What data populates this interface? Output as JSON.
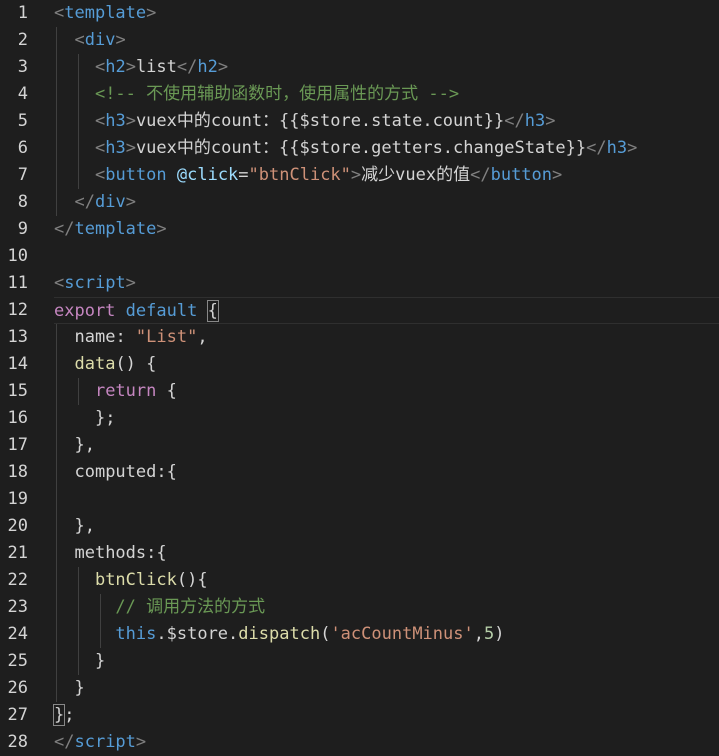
{
  "editor": {
    "line_numbers": [
      "1",
      "2",
      "3",
      "4",
      "5",
      "6",
      "7",
      "8",
      "9",
      "10",
      "11",
      "12",
      "13",
      "14",
      "15",
      "16",
      "17",
      "18",
      "19",
      "20",
      "21",
      "22",
      "23",
      "24",
      "25",
      "26",
      "27",
      "28"
    ],
    "lines": [
      [
        {
          "t": "<",
          "c": "punct"
        },
        {
          "t": "template",
          "c": "tag"
        },
        {
          "t": ">",
          "c": "punct"
        }
      ],
      [
        {
          "t": "  "
        },
        {
          "t": "<",
          "c": "punct"
        },
        {
          "t": "div",
          "c": "tag"
        },
        {
          "t": ">",
          "c": "punct"
        }
      ],
      [
        {
          "t": "    "
        },
        {
          "t": "<",
          "c": "punct"
        },
        {
          "t": "h2",
          "c": "tag"
        },
        {
          "t": ">",
          "c": "punct"
        },
        {
          "t": "list",
          "c": "txt"
        },
        {
          "t": "</",
          "c": "punct"
        },
        {
          "t": "h2",
          "c": "tag"
        },
        {
          "t": ">",
          "c": "punct"
        }
      ],
      [
        {
          "t": "    "
        },
        {
          "t": "<!-- 不使用辅助函数时，使用属性的方式 -->",
          "c": "com"
        }
      ],
      [
        {
          "t": "    "
        },
        {
          "t": "<",
          "c": "punct"
        },
        {
          "t": "h3",
          "c": "tag"
        },
        {
          "t": ">",
          "c": "punct"
        },
        {
          "t": "vuex中的count：{{$store.state.count}}",
          "c": "txt"
        },
        {
          "t": "</",
          "c": "punct"
        },
        {
          "t": "h3",
          "c": "tag"
        },
        {
          "t": ">",
          "c": "punct"
        }
      ],
      [
        {
          "t": "    "
        },
        {
          "t": "<",
          "c": "punct"
        },
        {
          "t": "h3",
          "c": "tag"
        },
        {
          "t": ">",
          "c": "punct"
        },
        {
          "t": "vuex中的count：{{$store.getters.changeState}}",
          "c": "txt"
        },
        {
          "t": "</",
          "c": "punct"
        },
        {
          "t": "h3",
          "c": "tag"
        },
        {
          "t": ">",
          "c": "punct"
        }
      ],
      [
        {
          "t": "    "
        },
        {
          "t": "<",
          "c": "punct"
        },
        {
          "t": "button",
          "c": "tag"
        },
        {
          "t": " "
        },
        {
          "t": "@click",
          "c": "attr"
        },
        {
          "t": "=",
          "c": "txt"
        },
        {
          "t": "\"btnClick\"",
          "c": "str"
        },
        {
          "t": ">",
          "c": "punct"
        },
        {
          "t": "减少vuex的值",
          "c": "txt"
        },
        {
          "t": "</",
          "c": "punct"
        },
        {
          "t": "button",
          "c": "tag"
        },
        {
          "t": ">",
          "c": "punct"
        }
      ],
      [
        {
          "t": "  "
        },
        {
          "t": "</",
          "c": "punct"
        },
        {
          "t": "div",
          "c": "tag"
        },
        {
          "t": ">",
          "c": "punct"
        }
      ],
      [
        {
          "t": "</",
          "c": "punct"
        },
        {
          "t": "template",
          "c": "tag"
        },
        {
          "t": ">",
          "c": "punct"
        }
      ],
      [],
      [
        {
          "t": "<",
          "c": "punct"
        },
        {
          "t": "script",
          "c": "tag"
        },
        {
          "t": ">",
          "c": "punct"
        }
      ],
      [
        {
          "t": "export",
          "c": "kw"
        },
        {
          "t": " "
        },
        {
          "t": "default",
          "c": "kw2"
        },
        {
          "t": " "
        },
        {
          "t": "{",
          "c": "txt bracket-box"
        }
      ],
      [
        {
          "t": "  "
        },
        {
          "t": "name",
          "c": "txt"
        },
        {
          "t": ": "
        },
        {
          "t": "\"List\"",
          "c": "str"
        },
        {
          "t": ","
        }
      ],
      [
        {
          "t": "  "
        },
        {
          "t": "data",
          "c": "fn"
        },
        {
          "t": "() {"
        }
      ],
      [
        {
          "t": "    "
        },
        {
          "t": "return",
          "c": "kw"
        },
        {
          "t": " {"
        }
      ],
      [
        {
          "t": "    "
        },
        {
          "t": "};"
        }
      ],
      [
        {
          "t": "  "
        },
        {
          "t": "},"
        }
      ],
      [
        {
          "t": "  "
        },
        {
          "t": "computed",
          "c": "txt"
        },
        {
          "t": ":{"
        }
      ],
      [],
      [
        {
          "t": "  "
        },
        {
          "t": "},"
        }
      ],
      [
        {
          "t": "  "
        },
        {
          "t": "methods",
          "c": "txt"
        },
        {
          "t": ":{"
        }
      ],
      [
        {
          "t": "    "
        },
        {
          "t": "btnClick",
          "c": "fn"
        },
        {
          "t": "(){"
        }
      ],
      [
        {
          "t": "      "
        },
        {
          "t": "// 调用方法的方式",
          "c": "com"
        }
      ],
      [
        {
          "t": "      "
        },
        {
          "t": "this",
          "c": "kw2"
        },
        {
          "t": "."
        },
        {
          "t": "$store",
          "c": "txt"
        },
        {
          "t": "."
        },
        {
          "t": "dispatch",
          "c": "fn"
        },
        {
          "t": "("
        },
        {
          "t": "'acCountMinus'",
          "c": "str"
        },
        {
          "t": ","
        },
        {
          "t": "5",
          "c": "num"
        },
        {
          "t": ")"
        }
      ],
      [
        {
          "t": "    "
        },
        {
          "t": "}"
        }
      ],
      [
        {
          "t": "  "
        },
        {
          "t": "}"
        }
      ],
      [
        {
          "t": "}",
          "c": "txt bracket-box"
        },
        {
          "t": ";"
        }
      ],
      [
        {
          "t": "</",
          "c": "punct"
        },
        {
          "t": "script",
          "c": "tag"
        },
        {
          "t": ">",
          "c": "punct"
        }
      ]
    ]
  }
}
